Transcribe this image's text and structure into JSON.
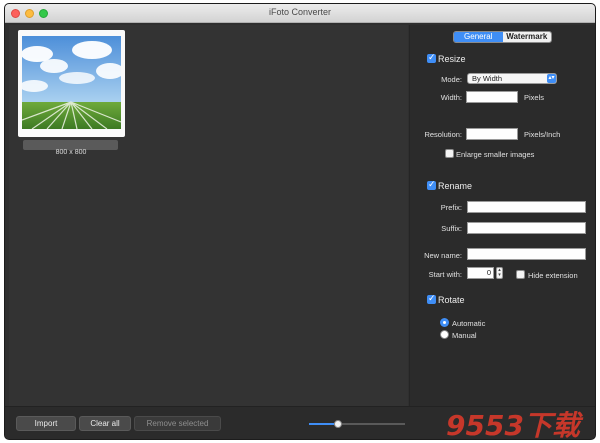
{
  "window": {
    "title": "iFoto Converter"
  },
  "thumbnail": {
    "caption": "800 x 800"
  },
  "tabs": [
    {
      "label": "General",
      "active": true
    },
    {
      "label": "Watermark",
      "active": false
    }
  ],
  "resize": {
    "label": "Resize",
    "checked": true,
    "mode_label": "Mode:",
    "mode_value": "By Width",
    "width_label": "Width:",
    "width_unit": "Pixels",
    "resolution_label": "Resolution:",
    "resolution_unit": "Pixels/Inch",
    "enlarge_label": "Enlarge smaller images"
  },
  "rename": {
    "label": "Rename",
    "checked": true,
    "prefix_label": "Prefix:",
    "suffix_label": "Suffix:",
    "newname_label": "New name:",
    "startwith_label": "Start with:",
    "startwith_value": "0",
    "hide_ext_label": "Hide extension"
  },
  "rotate": {
    "label": "Rotate",
    "checked": true,
    "automatic_label": "Automatic",
    "manual_label": "Manual"
  },
  "bottom": {
    "import_label": "Import",
    "clear_label": "Clear all",
    "remove_label": "Remove selected",
    "zoom_level": 0.3
  },
  "watermark_text": "9553下载",
  "colors": {
    "accent": "#3f8ef6",
    "background": "#2f2f2f"
  }
}
